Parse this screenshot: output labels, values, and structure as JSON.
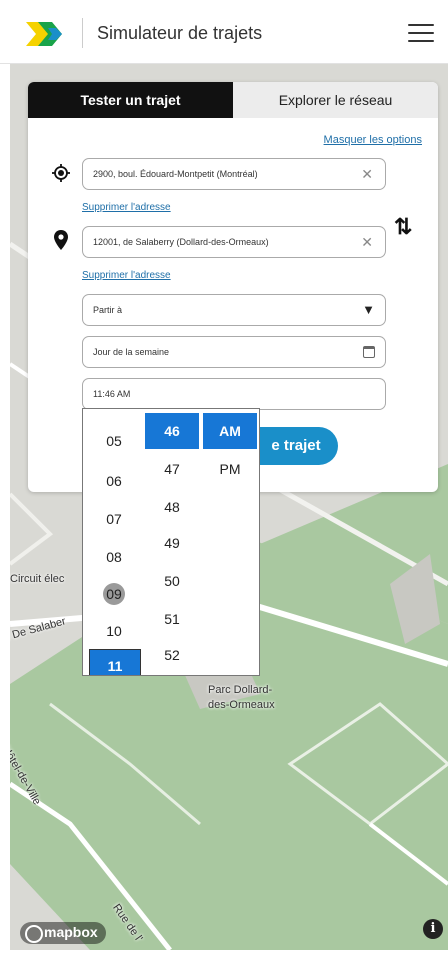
{
  "header": {
    "title": "Simulateur de trajets",
    "logo_colors": [
      "#f5d200",
      "#19a34a",
      "#1a8fc9"
    ],
    "menu_icon": "hamburger-icon"
  },
  "tabs": [
    {
      "label": "Tester un trajet",
      "active": true
    },
    {
      "label": "Explorer le réseau",
      "active": false
    }
  ],
  "options_link": "Masquer les options",
  "origin": {
    "value": "2900, boul. Édouard-Montpetit (Montréal)",
    "remove_link": "Supprimer l'adresse",
    "icon": "crosshair-icon"
  },
  "destination": {
    "value": "12001, de Salaberry (Dollard-des-Ormeaux)",
    "remove_link": "Supprimer l'adresse",
    "icon": "map-pin-icon"
  },
  "swap_icon": "swap-vertical-icon",
  "depart_select": {
    "value": "Partir à"
  },
  "day_field": {
    "value": "Jour de la semaine"
  },
  "time_field": {
    "value": "11:46 AM"
  },
  "search_button": {
    "visible_label": "e trajet"
  },
  "time_picker": {
    "hours": [
      "05",
      "06",
      "07",
      "08",
      "09",
      "10",
      "11"
    ],
    "hover_hour": "09",
    "selected_hour": "11",
    "minutes": [
      "46",
      "47",
      "48",
      "49",
      "50",
      "51",
      "52"
    ],
    "selected_minute": "46",
    "periods": [
      "AM",
      "PM"
    ],
    "selected_period": "AM",
    "selected_color": "#1777d6"
  },
  "map": {
    "labels": {
      "circuit": "Circuit élec",
      "street": "d De Salaber",
      "park_line1": "Parc Dollard-",
      "park_line2": "des-Ormeaux",
      "hotel": "Hôtel-de-Ville",
      "rue": "Rue de l'"
    },
    "attribution": "mapbox",
    "info_icon": "info-icon",
    "park_color": "#a9c8a0",
    "base_color": "#d9d9d4"
  }
}
